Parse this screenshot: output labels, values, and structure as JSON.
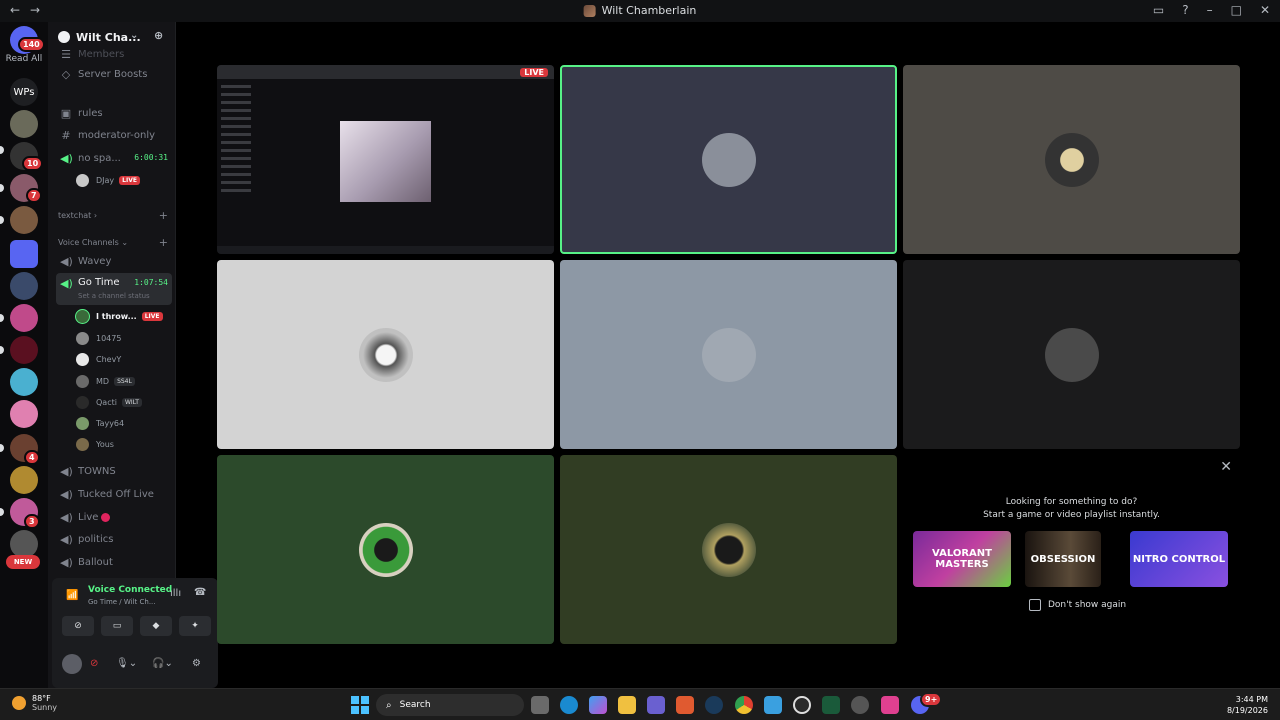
{
  "window": {
    "title": "Wilt Chamberlain"
  },
  "rail": {
    "home_badge": "140",
    "read_all": "Read All",
    "wps_label": "WPs",
    "badges": [
      "10",
      "7",
      "4",
      "3"
    ],
    "new_label": "NEW"
  },
  "server": {
    "name": "Wilt Cha..."
  },
  "channels": {
    "top": [
      {
        "name": "Members"
      },
      {
        "name": "Server Boosts"
      },
      {
        "name": "rules"
      },
      {
        "name": "moderator-only"
      },
      {
        "name": "no spa...",
        "timer": "6:00:31"
      }
    ],
    "no_spam_user": {
      "name": "DJay",
      "badge": "LIVE"
    },
    "category_textchat": "textchat",
    "category_voice": "Voice Channels",
    "voice_list": [
      {
        "name": "Wavey"
      },
      {
        "name": "Go Time",
        "timer": "1:07:54",
        "status": "Set a channel status"
      }
    ],
    "go_time_users": [
      {
        "name": "I throw...",
        "badge": "LIVE"
      },
      {
        "name": "10475"
      },
      {
        "name": "ChevY"
      },
      {
        "name": "MD",
        "tag": "SS4L"
      },
      {
        "name": "Qacti",
        "tag": "WILT"
      },
      {
        "name": "Tayy64"
      },
      {
        "name": "Yous"
      }
    ],
    "bottom": [
      {
        "name": "TOWNS"
      },
      {
        "name": "Tucked Off Live"
      },
      {
        "name": "Live"
      },
      {
        "name": "politics"
      },
      {
        "name": "Ballout"
      }
    ]
  },
  "voice_panel": {
    "status": "Voice Connected",
    "sub": "Go Time / Wilt Ch..."
  },
  "stream": {
    "live_label": "LIVE"
  },
  "tiles": [
    {
      "bg": "#0f0f12",
      "type": "stream"
    },
    {
      "bg": "#363848",
      "avatar": "#8a8f9a",
      "speaking": true
    },
    {
      "bg": "#4e4b46",
      "avatar": "#c9a552"
    },
    {
      "bg": "#d3d3d3",
      "avatar": "#7a7a7a"
    },
    {
      "bg": "#8d98a5",
      "avatar": "#2c2c2c"
    },
    {
      "bg": "#1b1b1c",
      "avatar": "#555555"
    },
    {
      "bg": "#2c4a2b",
      "avatar": "#3a7a30"
    },
    {
      "bg": "#313d23",
      "avatar": "#9a8a50"
    }
  ],
  "suggestions": {
    "line1": "Looking for something to do?",
    "line2": "Start a game or video playlist instantly.",
    "cards": [
      "VALORANT MASTERS",
      "OBSESSION",
      "NITRO CONTROL"
    ],
    "checkbox_label": "Don't show again"
  },
  "taskbar": {
    "temp": "88°F",
    "weather": "Sunny",
    "search_placeholder": "Search",
    "time": "3:44 PM",
    "date": "8/19/2026",
    "discord_badge": "9+"
  }
}
